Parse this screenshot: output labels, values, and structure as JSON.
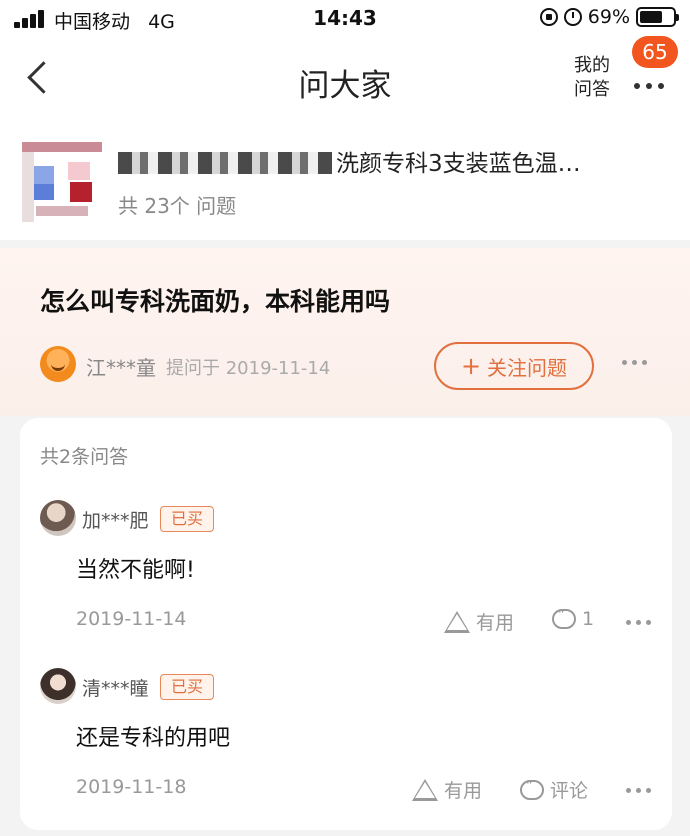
{
  "status_bar": {
    "carrier": "中国移动",
    "network": "4G",
    "time": "14:43",
    "battery": "69%",
    "battery_level": 0.69
  },
  "nav": {
    "title": "问大家",
    "my_qa": "我的问答",
    "badge": "65"
  },
  "product": {
    "title_suffix": "洗颜专科3支装蓝色温…",
    "question_count": "共 23个 问题"
  },
  "question": {
    "text": "怎么叫专科洗面奶，本科能用吗",
    "asker": "江***童",
    "asked_on": "提问于 2019-11-14",
    "follow_label": "关注问题"
  },
  "answers": {
    "count_label": "共2条问答",
    "items": [
      {
        "user": "加***肥",
        "badge": "已买",
        "text": "当然不能啊!",
        "date": "2019-11-14",
        "useful": "有用",
        "comment": "1"
      },
      {
        "user": "清***瞳",
        "badge": "已买",
        "text": "还是专科的用吧",
        "date": "2019-11-18",
        "useful": "有用",
        "comment": "评论"
      }
    ]
  },
  "colors": {
    "accent": "#e2703f",
    "badge": "#f2551d",
    "question_bg": "#fbefea"
  }
}
